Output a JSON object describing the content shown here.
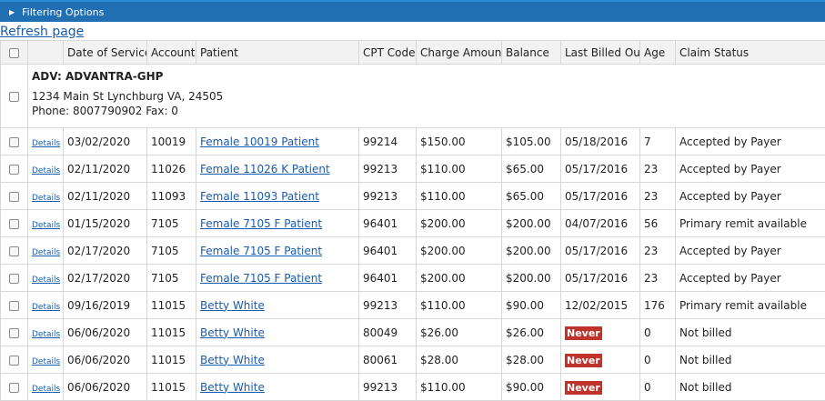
{
  "filter_bar": {
    "label": "Filtering Options"
  },
  "refresh_link": "Refresh page",
  "columns": [
    "Date of Service",
    "Account",
    "Patient",
    "CPT Code",
    "Charge Amount",
    "Balance",
    "Last Billed Out",
    "Age",
    "Claim Status"
  ],
  "payer": {
    "name": "ADV: ADVANTRA-GHP",
    "address": "1234 Main St Lynchburg VA, 24505",
    "phone_fax": "Phone: 8007790902 Fax: 0"
  },
  "details_label": "Details",
  "rows": [
    {
      "date": "03/02/2020",
      "account": "10019",
      "patient": "Female 10019 Patient",
      "cpt": "99214",
      "charge": "$150.00",
      "balance": "$105.00",
      "last_billed": "05/18/2016",
      "age": "7",
      "status": "Accepted by Payer"
    },
    {
      "date": "02/11/2020",
      "account": "11026",
      "patient": "Female 11026 K Patient",
      "cpt": "99213",
      "charge": "$110.00",
      "balance": "$65.00",
      "last_billed": "05/17/2016",
      "age": "23",
      "status": "Accepted by Payer"
    },
    {
      "date": "02/11/2020",
      "account": "11093",
      "patient": "Female 11093 Patient",
      "cpt": "99213",
      "charge": "$110.00",
      "balance": "$65.00",
      "last_billed": "05/17/2016",
      "age": "23",
      "status": "Accepted by Payer"
    },
    {
      "date": "01/15/2020",
      "account": "7105",
      "patient": "Female 7105 F Patient",
      "cpt": "96401",
      "charge": "$200.00",
      "balance": "$200.00",
      "last_billed": "04/07/2016",
      "age": "56",
      "status": "Primary remit available"
    },
    {
      "date": "02/17/2020",
      "account": "7105",
      "patient": "Female 7105 F Patient",
      "cpt": "96401",
      "charge": "$200.00",
      "balance": "$200.00",
      "last_billed": "05/17/2016",
      "age": "23",
      "status": "Accepted by Payer"
    },
    {
      "date": "02/17/2020",
      "account": "7105",
      "patient": "Female 7105 F Patient",
      "cpt": "96401",
      "charge": "$200.00",
      "balance": "$200.00",
      "last_billed": "05/17/2016",
      "age": "23",
      "status": "Accepted by Payer"
    },
    {
      "date": "09/16/2019",
      "account": "11015",
      "patient": "Betty White",
      "cpt": "99213",
      "charge": "$110.00",
      "balance": "$90.00",
      "last_billed": "12/02/2015",
      "age": "176",
      "status": "Primary remit available"
    },
    {
      "date": "06/06/2020",
      "account": "11015",
      "patient": "Betty White",
      "cpt": "80049",
      "charge": "$26.00",
      "balance": "$26.00",
      "last_billed": "Never",
      "age": "0",
      "status": "Not billed"
    },
    {
      "date": "06/06/2020",
      "account": "11015",
      "patient": "Betty White",
      "cpt": "80061",
      "charge": "$28.00",
      "balance": "$28.00",
      "last_billed": "Never",
      "age": "0",
      "status": "Not billed"
    },
    {
      "date": "06/06/2020",
      "account": "11015",
      "patient": "Betty White",
      "cpt": "99213",
      "charge": "$110.00",
      "balance": "$90.00",
      "last_billed": "Never",
      "age": "0",
      "status": "Not billed"
    }
  ],
  "colors": {
    "header_bar": "#1f6fb2",
    "link": "#1a5bb0",
    "never_badge": "#c0332b"
  }
}
